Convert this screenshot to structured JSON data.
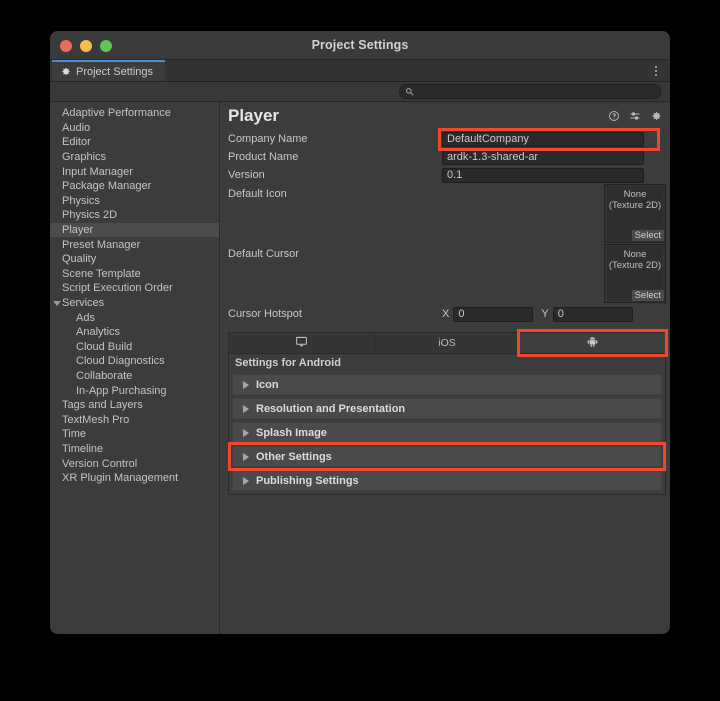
{
  "window": {
    "title": "Project Settings",
    "traffic_lights": [
      "close",
      "minimize",
      "zoom"
    ]
  },
  "tabstrip": {
    "tab_label": "Project Settings",
    "tab_icon": "gear-icon",
    "menu_icon": "kebab-menu-icon"
  },
  "search": {
    "icon": "search-icon",
    "value": "",
    "placeholder": ""
  },
  "sidebar": {
    "items": [
      {
        "label": "Adaptive Performance",
        "level": 0,
        "selected": false,
        "expandable": false
      },
      {
        "label": "Audio",
        "level": 0,
        "selected": false,
        "expandable": false
      },
      {
        "label": "Editor",
        "level": 0,
        "selected": false,
        "expandable": false
      },
      {
        "label": "Graphics",
        "level": 0,
        "selected": false,
        "expandable": false
      },
      {
        "label": "Input Manager",
        "level": 0,
        "selected": false,
        "expandable": false
      },
      {
        "label": "Package Manager",
        "level": 0,
        "selected": false,
        "expandable": false
      },
      {
        "label": "Physics",
        "level": 0,
        "selected": false,
        "expandable": false
      },
      {
        "label": "Physics 2D",
        "level": 0,
        "selected": false,
        "expandable": false
      },
      {
        "label": "Player",
        "level": 0,
        "selected": true,
        "expandable": false
      },
      {
        "label": "Preset Manager",
        "level": 0,
        "selected": false,
        "expandable": false
      },
      {
        "label": "Quality",
        "level": 0,
        "selected": false,
        "expandable": false
      },
      {
        "label": "Scene Template",
        "level": 0,
        "selected": false,
        "expandable": false
      },
      {
        "label": "Script Execution Order",
        "level": 0,
        "selected": false,
        "expandable": false
      },
      {
        "label": "Services",
        "level": 0,
        "selected": false,
        "expandable": true
      },
      {
        "label": "Ads",
        "level": 1,
        "selected": false,
        "expandable": false
      },
      {
        "label": "Analytics",
        "level": 1,
        "selected": false,
        "expandable": false
      },
      {
        "label": "Cloud Build",
        "level": 1,
        "selected": false,
        "expandable": false
      },
      {
        "label": "Cloud Diagnostics",
        "level": 1,
        "selected": false,
        "expandable": false
      },
      {
        "label": "Collaborate",
        "level": 1,
        "selected": false,
        "expandable": false
      },
      {
        "label": "In-App Purchasing",
        "level": 1,
        "selected": false,
        "expandable": false
      },
      {
        "label": "Tags and Layers",
        "level": 0,
        "selected": false,
        "expandable": false
      },
      {
        "label": "TextMesh Pro",
        "level": 0,
        "selected": false,
        "expandable": false
      },
      {
        "label": "Time",
        "level": 0,
        "selected": false,
        "expandable": false
      },
      {
        "label": "Timeline",
        "level": 0,
        "selected": false,
        "expandable": false
      },
      {
        "label": "Version Control",
        "level": 0,
        "selected": false,
        "expandable": false
      },
      {
        "label": "XR Plugin Management",
        "level": 0,
        "selected": false,
        "expandable": false
      }
    ]
  },
  "main": {
    "title": "Player",
    "header_icons": [
      "help-icon",
      "preset-icon",
      "gear-icon"
    ],
    "fields": {
      "company_name": {
        "label": "Company Name",
        "value": "DefaultCompany",
        "highlighted": true
      },
      "product_name": {
        "label": "Product Name",
        "value": "ardk-1.3-shared-ar",
        "highlighted": false
      },
      "version": {
        "label": "Version",
        "value": "0.1",
        "highlighted": false
      }
    },
    "object_fields": [
      {
        "label": "Default Icon",
        "value": "None",
        "type_line": "(Texture 2D)",
        "select_label": "Select"
      },
      {
        "label": "Default Cursor",
        "value": "None",
        "type_line": "(Texture 2D)",
        "select_label": "Select"
      }
    ],
    "cursor_hotspot": {
      "label": "Cursor Hotspot",
      "x_label": "X",
      "x_value": "0",
      "y_label": "Y",
      "y_value": "0"
    },
    "platform_tabs": [
      {
        "name": "standalone",
        "label": "",
        "icon": "desktop-monitor-icon",
        "active": false,
        "highlighted": false
      },
      {
        "name": "ios",
        "label": "iOS",
        "icon": "",
        "active": false,
        "highlighted": false
      },
      {
        "name": "android",
        "label": "",
        "icon": "android-robot-icon",
        "active": true,
        "highlighted": true
      }
    ],
    "settings_for": "Settings for Android",
    "sections": [
      {
        "label": "Icon",
        "expanded": false,
        "highlighted": false
      },
      {
        "label": "Resolution and Presentation",
        "expanded": false,
        "highlighted": false
      },
      {
        "label": "Splash Image",
        "expanded": false,
        "highlighted": false
      },
      {
        "label": "Other Settings",
        "expanded": false,
        "highlighted": true
      },
      {
        "label": "Publishing Settings",
        "expanded": false,
        "highlighted": false
      }
    ]
  },
  "annotations": {
    "highlight_color": "#f0482a",
    "boxes": [
      {
        "target": "company-name-field"
      },
      {
        "target": "android-platform-tab"
      },
      {
        "target": "other-settings-section"
      }
    ]
  }
}
